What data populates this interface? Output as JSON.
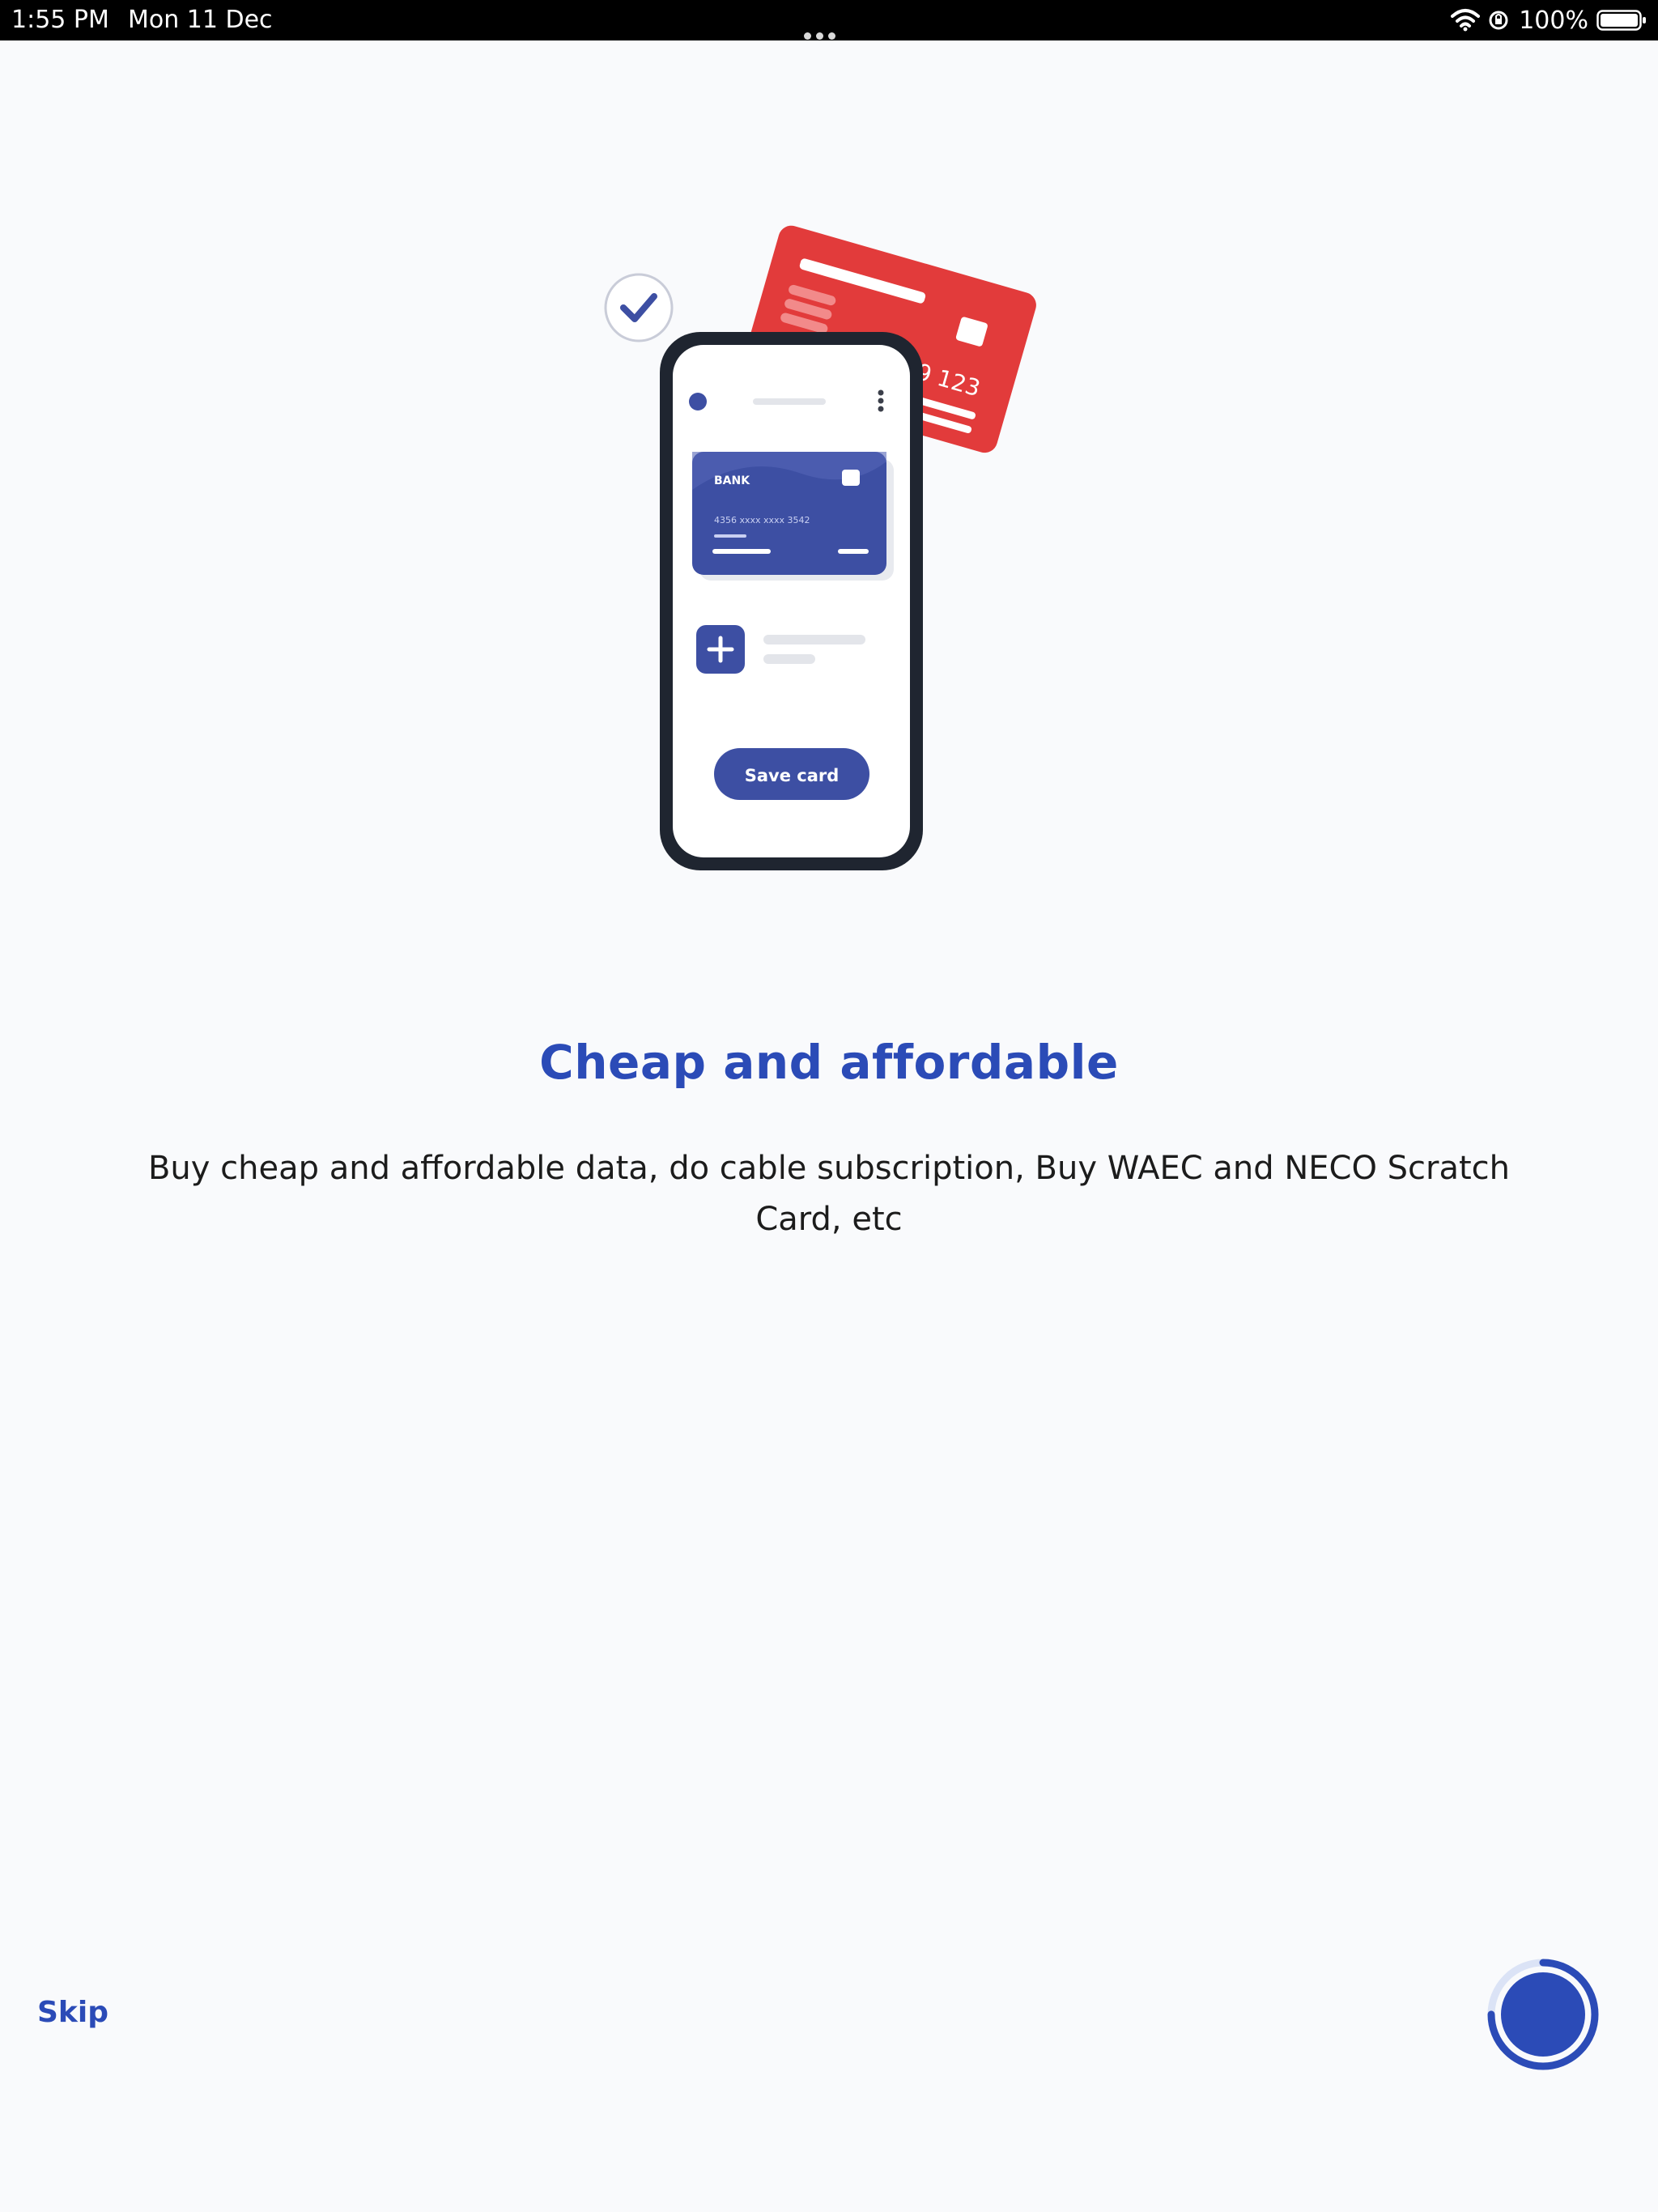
{
  "status_bar": {
    "time": "1:55 PM",
    "date": "Mon 11 Dec",
    "battery_percent": "100%",
    "battery_level": 1.0
  },
  "illustration": {
    "bank_label": "BANK",
    "card_number": "4356  xxxx  xxxx  3542",
    "red_card_number": "789 123",
    "save_button_label": "Save card"
  },
  "onboarding": {
    "title": "Cheap and affordable",
    "description": "Buy cheap and affordable data, do cable subscription, Buy WAEC and NECO Scratch Card, etc",
    "skip_label": "Skip",
    "progress_fraction": 0.75
  },
  "colors": {
    "accent": "#2b4bb7",
    "red_card": "#e23b3b",
    "card_blue": "#3d4fa3",
    "background": "#f9fafc"
  },
  "icons": {
    "wifi": "wifi-icon",
    "orientation_lock": "orientation-lock-icon",
    "battery": "battery-icon",
    "check": "check-icon",
    "plus": "plus-icon",
    "next": "next-progress-icon"
  }
}
